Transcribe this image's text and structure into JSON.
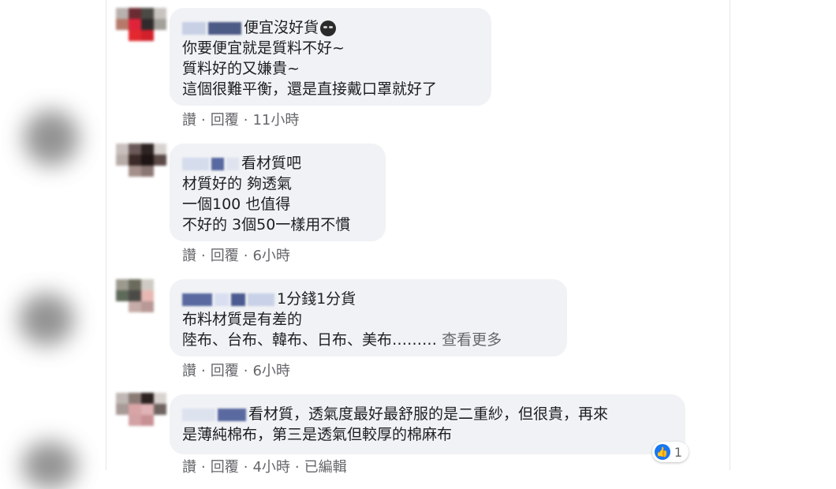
{
  "comments": [
    {
      "name_visible": "便宜沒好貨",
      "emoji": "black-face-emoji",
      "lines": [
        "你要便宜就是質料不好~",
        "質料好的又嫌貴~",
        "這個很難平衡，還是直接戴口罩就好了"
      ],
      "actions": {
        "like": "讚",
        "reply": "回覆",
        "time": "11小時"
      }
    },
    {
      "name_visible": "看材質吧",
      "lines": [
        "材質好的 夠透氣",
        "一個100 也值得",
        "不好的 3個50一樣用不慣"
      ],
      "actions": {
        "like": "讚",
        "reply": "回覆",
        "time": "6小時"
      }
    },
    {
      "name_visible": "1分錢1分貨",
      "lines": [
        "布料材質是有差的",
        "陸布、台布、韓布、日布、美布………"
      ],
      "see_more": "查看更多",
      "actions": {
        "like": "讚",
        "reply": "回覆",
        "time": "6小時"
      }
    },
    {
      "name_visible": "看材質，透氣度最好最舒服的是二重紗，但很貴，再來",
      "lines": [
        "是薄純棉布，第三是透氣但較厚的棉麻布"
      ],
      "actions": {
        "like": "讚",
        "reply": "回覆",
        "time": "4小時",
        "edited": "已編輯"
      },
      "reaction": {
        "icon": "thumbs-up-icon",
        "count": "1"
      }
    }
  ],
  "separator": "·"
}
